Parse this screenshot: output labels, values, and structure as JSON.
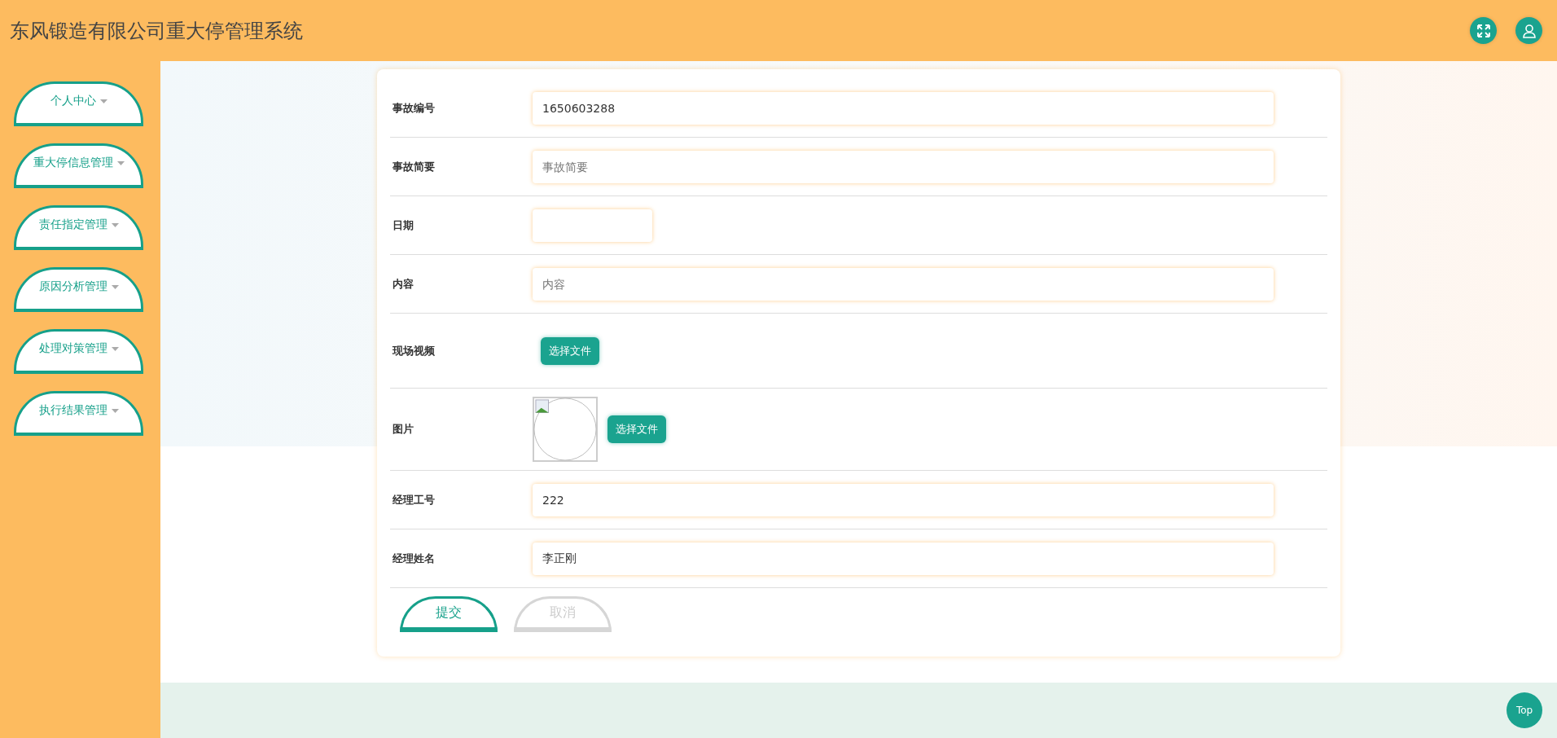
{
  "header": {
    "title": "东风锻造有限公司重大停管理系统"
  },
  "sidebar": {
    "items": [
      {
        "label": "个人中心"
      },
      {
        "label": "重大停信息管理"
      },
      {
        "label": "责任指定管理"
      },
      {
        "label": "原因分析管理"
      },
      {
        "label": "处理对策管理"
      },
      {
        "label": "执行结果管理"
      }
    ]
  },
  "form": {
    "fields": [
      {
        "kind": "text",
        "label": "事故编号",
        "value": "1650603288"
      },
      {
        "kind": "text",
        "label": "事故简要",
        "placeholder": "事故简要"
      },
      {
        "kind": "date",
        "label": "日期"
      },
      {
        "kind": "text",
        "label": "内容",
        "placeholder": "内容"
      },
      {
        "kind": "file",
        "label": "现场视频",
        "button": "选择文件"
      },
      {
        "kind": "image",
        "label": "图片",
        "button": "选择文件"
      },
      {
        "kind": "text",
        "label": "经理工号",
        "value": "222"
      },
      {
        "kind": "text",
        "label": "经理姓名",
        "value": "李正刚"
      }
    ],
    "buttons": [
      {
        "kind": "primary",
        "label": "提交"
      },
      {
        "kind": "secondary",
        "label": "取消"
      }
    ]
  },
  "top_button": "Top"
}
